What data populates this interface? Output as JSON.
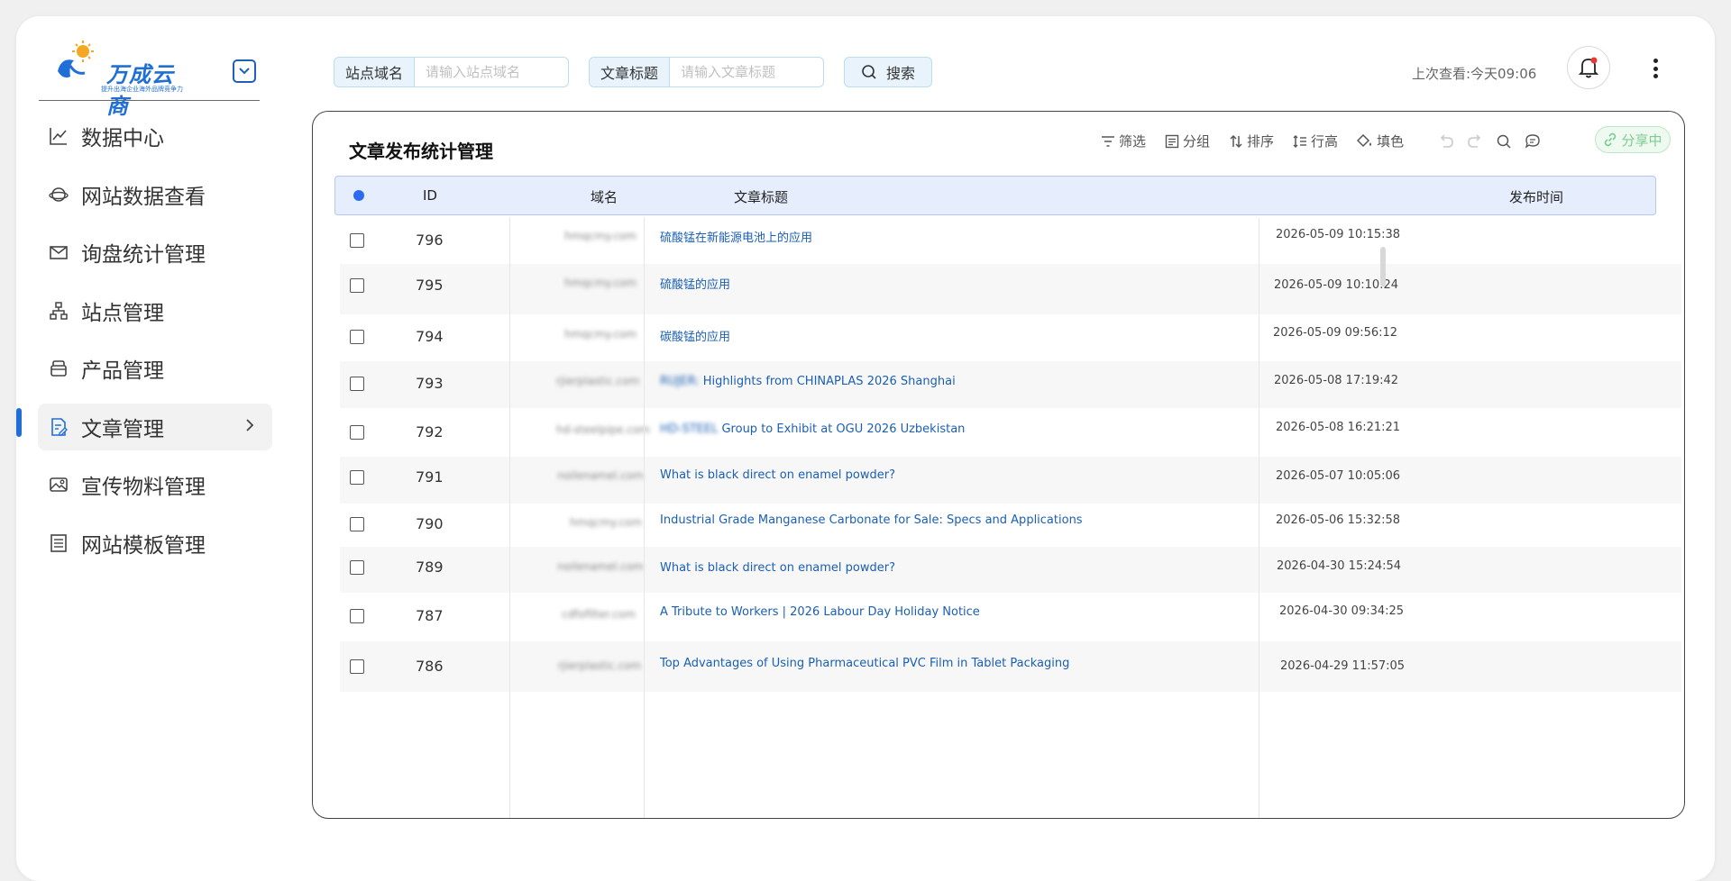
{
  "brand": {
    "name": "万成云商",
    "slogan": "提升出海企业海外品牌竞争力"
  },
  "sidebar": {
    "items": [
      {
        "label": "数据中心",
        "icon": "line-chart-icon"
      },
      {
        "label": "网站数据查看",
        "icon": "globe-orbit-icon"
      },
      {
        "label": "询盘统计管理",
        "icon": "mail-inbox-icon"
      },
      {
        "label": "站点管理",
        "icon": "sitemap-icon"
      },
      {
        "label": "产品管理",
        "icon": "box-icon"
      },
      {
        "label": "文章管理",
        "icon": "document-edit-icon",
        "active": true
      },
      {
        "label": "宣传物料管理",
        "icon": "image-icon"
      },
      {
        "label": "网站模板管理",
        "icon": "list-document-icon"
      }
    ]
  },
  "search": {
    "site_label": "站点域名",
    "site_placeholder": "请输入站点域名",
    "title_label": "文章标题",
    "title_placeholder": "请输入文章标题",
    "button_label": "搜索"
  },
  "header": {
    "last_view": "上次查看:今天09:06"
  },
  "card": {
    "title": "文章发布统计管理",
    "toolbar": {
      "filter": "筛选",
      "group": "分组",
      "sort": "排序",
      "row_height": "行高",
      "fill": "填色",
      "share": "分享中"
    }
  },
  "table": {
    "columns": [
      "ID",
      "域名",
      "文章标题",
      "发布时间"
    ],
    "rows": [
      {
        "id": "796",
        "domain": "hmqcmy.com",
        "title_prefix": "",
        "title": "硫酸锰在新能源电池上的应用",
        "time": "2026-05-09 10:15:38"
      },
      {
        "id": "795",
        "domain": "hmqcmy.com",
        "title_prefix": "",
        "title": "硫酸锰的应用",
        "time": "2026-05-09 10:10:24"
      },
      {
        "id": "794",
        "domain": "hmqcmy.com",
        "title_prefix": "",
        "title": "碳酸锰的应用",
        "time": "2026-05-09 09:56:12"
      },
      {
        "id": "793",
        "domain": "rjierplastic.com",
        "title_prefix": "RUJER:",
        "title": "Highlights from CHINAPLAS 2026 Shanghai",
        "time": "2026-05-08 17:19:42"
      },
      {
        "id": "792",
        "domain": "hd-steelpipe.com",
        "title_prefix": "HD-STEEL",
        "title": "Group to Exhibit at OGU 2026 Uzbekistan",
        "time": "2026-05-08 16:21:21"
      },
      {
        "id": "791",
        "domain": "noilenamel.com",
        "title_prefix": "",
        "title": "What is black direct on enamel powder?",
        "time": "2026-05-07 10:05:06"
      },
      {
        "id": "790",
        "domain": "hmqcmy.com",
        "title_prefix": "",
        "title": "Industrial Grade Manganese Carbonate for Sale: Specs and Applications",
        "time": "2026-05-06 15:32:58"
      },
      {
        "id": "789",
        "domain": "noilenamel.com",
        "title_prefix": "",
        "title": "What is black direct on enamel powder?",
        "time": "2026-04-30 15:24:54"
      },
      {
        "id": "787",
        "domain": "cdfofilter.com",
        "title_prefix": "",
        "title": "A Tribute to Workers | 2026 Labour Day Holiday Notice",
        "time": "2026-04-30 09:34:25"
      },
      {
        "id": "786",
        "domain": "rjierplastic.com",
        "title_prefix": "",
        "title": "Top Advantages of Using Pharmaceutical PVC Film in Tablet Packaging",
        "time": "2026-04-29 11:57:05"
      }
    ]
  },
  "colors": {
    "accent": "#1f6fd6",
    "link": "#1a5fb4",
    "share_green": "#7ccb91",
    "header_bg": "#e6edfc"
  }
}
